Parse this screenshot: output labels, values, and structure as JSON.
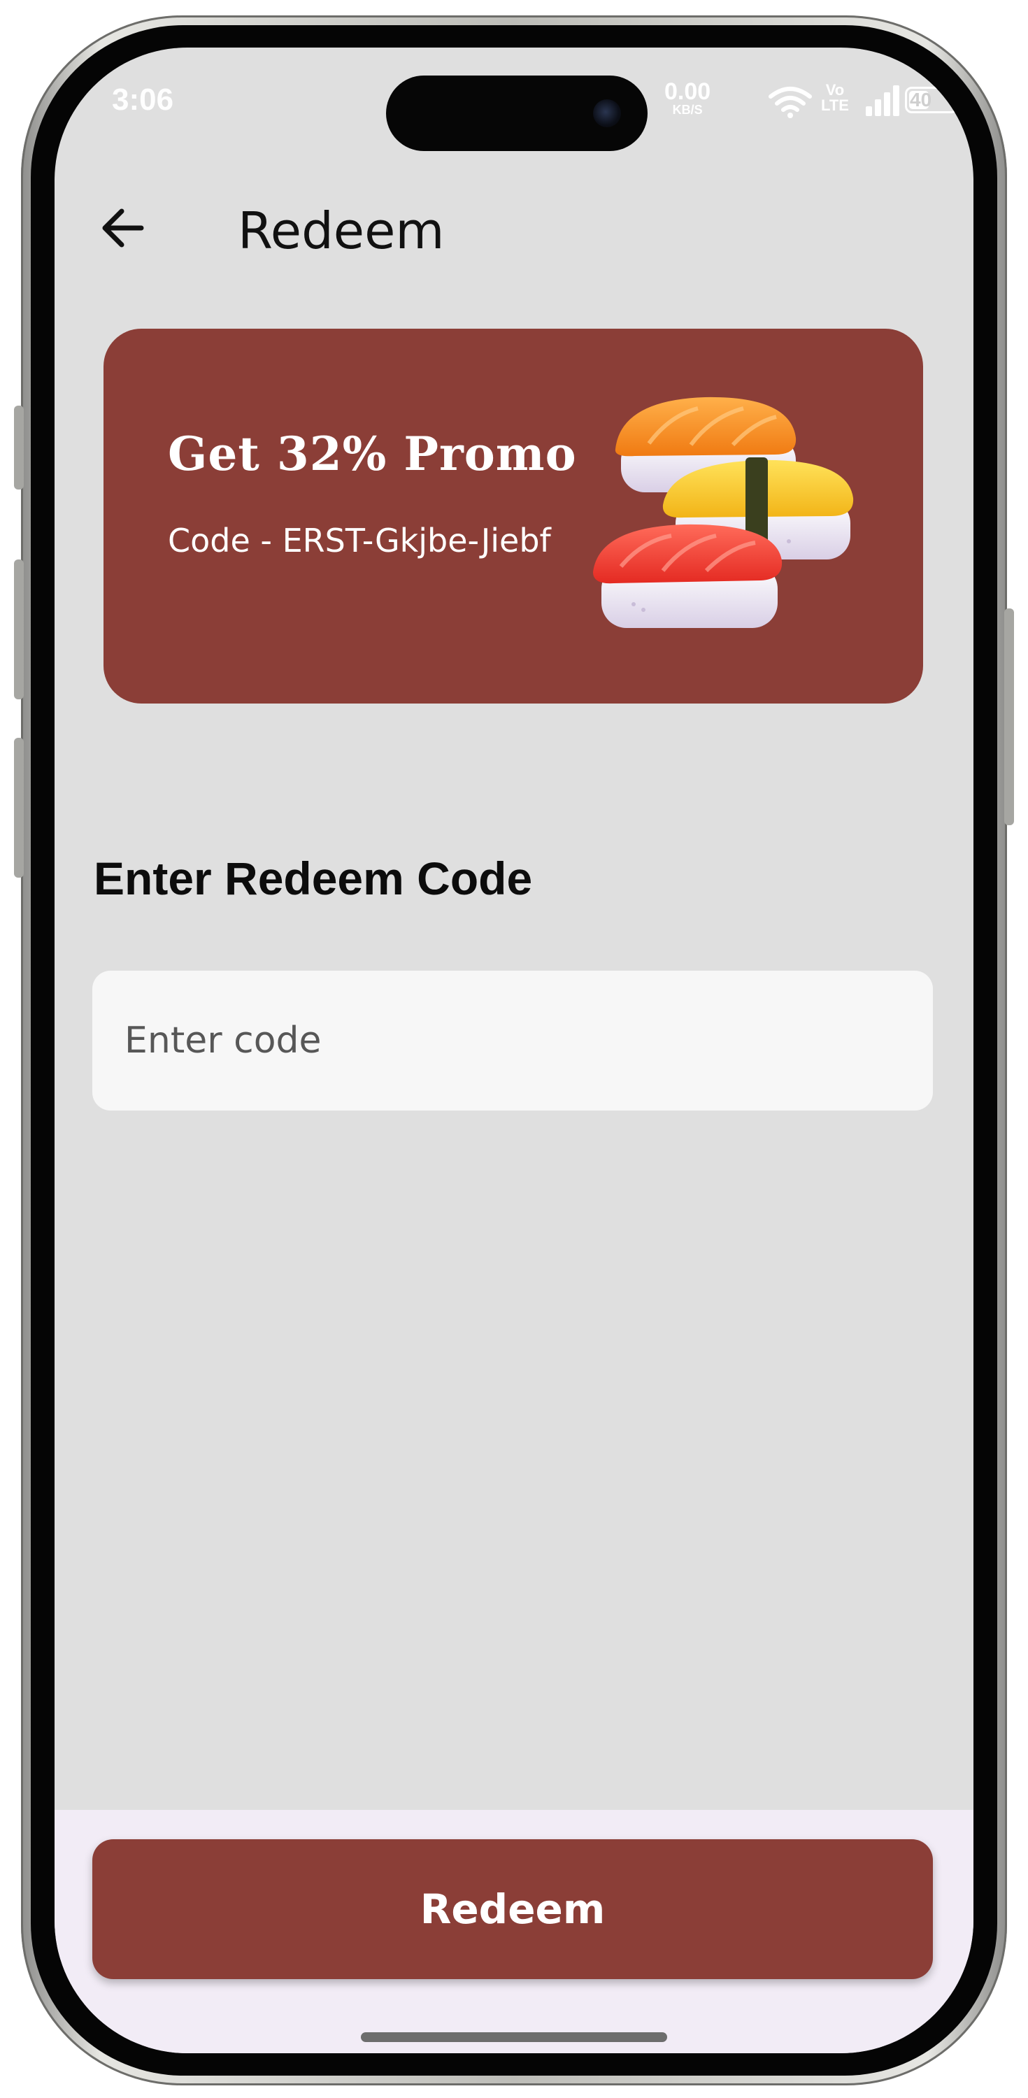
{
  "status_bar": {
    "time": "3:06",
    "net_speed": "0.00",
    "net_speed_unit": "KB/S",
    "volte_top": "Vo",
    "volte_bottom": "LTE",
    "battery": "40"
  },
  "app_bar": {
    "title": "Redeem",
    "back_icon": "arrow-left-icon"
  },
  "promo": {
    "title": "Get 32% Promo",
    "code_text": "Code - ERST-Gkjbe-Jiebf",
    "background": "#8b3e37",
    "image": "sushi-illustration"
  },
  "form": {
    "section_title": "Enter Redeem Code",
    "input_placeholder": "Enter code",
    "input_value": ""
  },
  "footer": {
    "button_label": "Redeem",
    "button_color": "#8b3e37"
  },
  "colors": {
    "screen_bg": "#dfdfdf",
    "bottom_bar_bg": "#f2ecf6"
  }
}
